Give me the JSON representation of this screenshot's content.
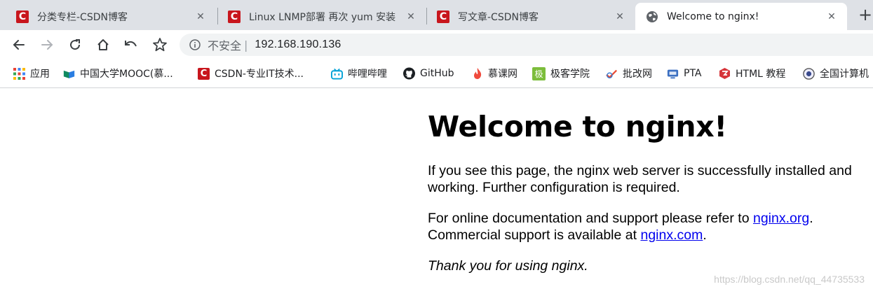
{
  "tabs": [
    {
      "title": "分类专栏-CSDN博客",
      "favicon": "csdn-logo-icon",
      "active": false
    },
    {
      "title": "Linux LNMP部署 再次 yum 安装",
      "favicon": "csdn-logo-icon",
      "active": false
    },
    {
      "title": "写文章-CSDN博客",
      "favicon": "csdn-logo-icon",
      "active": false
    },
    {
      "title": "Welcome to nginx!",
      "favicon": "globe-icon",
      "active": true
    }
  ],
  "toolbar": {
    "security_label": "不安全",
    "separator": "|",
    "url": "192.168.190.136"
  },
  "bookmarks": [
    {
      "label": "应用",
      "icon": "apps-grid-icon"
    },
    {
      "label": "中国大学MOOC(慕...",
      "icon": "mooc-icon"
    },
    {
      "label": "CSDN-专业IT技术...",
      "icon": "csdn-logo-icon"
    },
    {
      "label": "哔哩哔哩",
      "icon": "bilibili-icon"
    },
    {
      "label": "GitHub",
      "icon": "github-icon"
    },
    {
      "label": "慕课网",
      "icon": "imooc-flame-icon"
    },
    {
      "label": "极客学院",
      "icon": "jikexueyuan-icon"
    },
    {
      "label": "批改网",
      "icon": "pigai-icon"
    },
    {
      "label": "PTA",
      "icon": "pta-icon"
    },
    {
      "label": "HTML 教程",
      "icon": "runoob-icon"
    },
    {
      "label": "全国计算机",
      "icon": "ncre-icon"
    }
  ],
  "page": {
    "heading": "Welcome to nginx!",
    "p1": "If you see this page, the nginx web server is successfully installed and working. Further configuration is required.",
    "p2_before": "For online documentation and support please refer to ",
    "link1": "nginx.org",
    "p2_middle": ". Commercial support is available at ",
    "link2": "nginx.com",
    "p2_after": ".",
    "p3": "Thank you for using nginx."
  },
  "watermark": "https://blog.csdn.net/qq_44735533",
  "colors": {
    "tabstrip_bg": "#dee1e6",
    "csdn_red": "#c8161d",
    "link": "#0000ee",
    "omnibox_bg": "#f1f3f4"
  }
}
